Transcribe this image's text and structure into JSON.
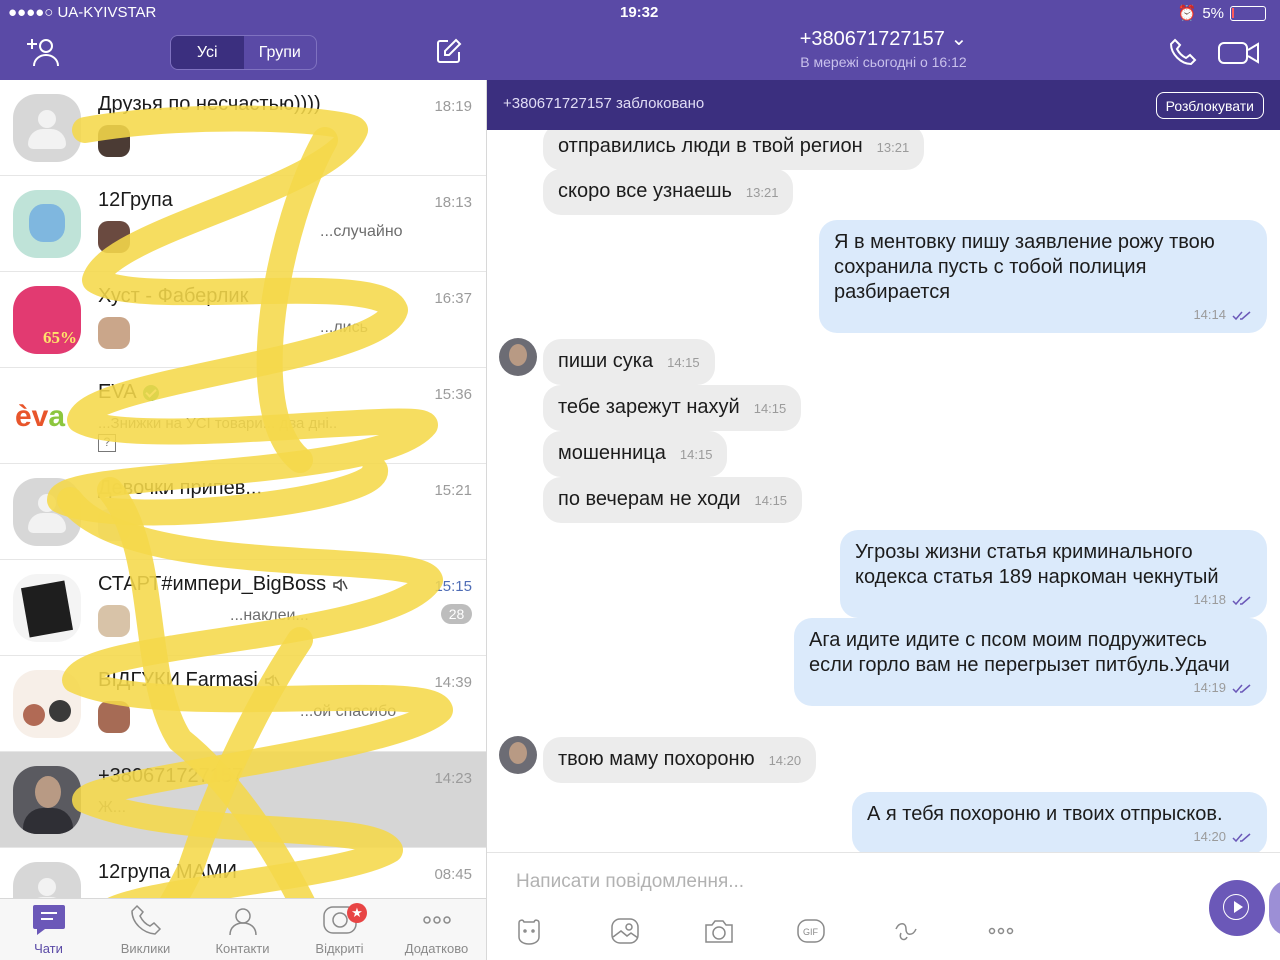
{
  "status_bar": {
    "carrier": "●●●●○ UA-KYIVSTAR",
    "time": "19:32",
    "battery": "5%"
  },
  "list_header": {
    "tabs": [
      "Усі",
      "Групи"
    ]
  },
  "chats": [
    {
      "name": "Друзья по несчастью))))",
      "time": "18:19",
      "preview": ""
    },
    {
      "name": "12Група",
      "time": "18:13",
      "preview": "...случайно"
    },
    {
      "name": "Хуст - Фаберлик",
      "time": "16:37",
      "preview": "...лись"
    },
    {
      "name": "EVA",
      "time": "15:36",
      "preview": "...Знижки на УСІ товари... два дні.."
    },
    {
      "name": "Девочки припев...",
      "time": "15:21",
      "preview": ""
    },
    {
      "name": "СТАРТ#импери_BigBoss",
      "time": "15:15",
      "preview": "...наклеи...",
      "unread": "28"
    },
    {
      "name": "ВІДГУКИ Farmasi",
      "time": "14:39",
      "preview": "...ой спасибо"
    },
    {
      "name": "+380671727157",
      "time": "14:23",
      "preview": "Ж..."
    },
    {
      "name": "12група МАМИ",
      "time": "08:45",
      "preview": ""
    }
  ],
  "tabbar": {
    "items": [
      {
        "label": "Чати",
        "icon": "chat-bubble-icon"
      },
      {
        "label": "Виклики",
        "icon": "phone-icon"
      },
      {
        "label": "Контакти",
        "icon": "contacts-icon"
      },
      {
        "label": "Відкриті",
        "icon": "public-chats-icon",
        "badge": "★"
      },
      {
        "label": "Додатково",
        "icon": "more-dots-icon"
      }
    ]
  },
  "conversation": {
    "title": "+380671727157 ⌄",
    "subtitle": "В мережі сьогодні о 16:12",
    "blocked_text": "+380671727157 заблоковано",
    "unblock_label": "Розблокувати",
    "composer_placeholder": "Написати повідомлення...",
    "messages": [
      {
        "dir": "in",
        "text": "отправились люди в твой регион",
        "time": "13:21"
      },
      {
        "dir": "in",
        "text": "скоро все узнаешь",
        "time": "13:21"
      },
      {
        "dir": "out",
        "text": "Я в ментовку пишу заявление рожу твою сохранила пусть с тобой полиция разбирается",
        "time": "14:14"
      },
      {
        "dir": "in",
        "text": "пиши сука",
        "time": "14:15"
      },
      {
        "dir": "in",
        "text": "тебе зарежут нахуй",
        "time": "14:15"
      },
      {
        "dir": "in",
        "text": "мошенница",
        "time": "14:15"
      },
      {
        "dir": "in",
        "text": "по вечерам не ходи",
        "time": "14:15"
      },
      {
        "dir": "out",
        "text": "Угрозы жизни статья криминального кодекса статья 189 наркоман чекнутый",
        "time": "14:18"
      },
      {
        "dir": "out",
        "text": "Ага идите идите с псом моим подружитесь если горло вам не перегрызет питбуль.Удачи",
        "time": "14:19"
      },
      {
        "dir": "in",
        "text": "твою маму похороню",
        "time": "14:20"
      },
      {
        "dir": "out",
        "text": "А я тебя похороню и твоих отпрысков.",
        "time": "14:20"
      }
    ]
  },
  "colors": {
    "header": "#5a4aa6",
    "blocked_bar": "#3b2f7f",
    "incoming": "#ececec",
    "outgoing": "#dbeafb",
    "scribble": "#f5d84a"
  }
}
